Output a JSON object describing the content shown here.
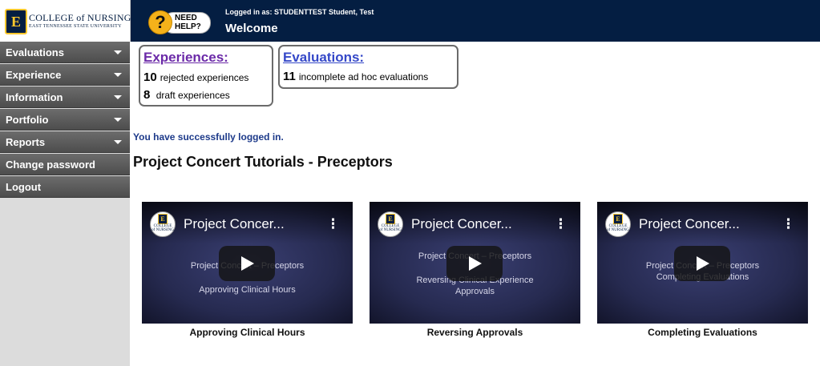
{
  "header": {
    "logo_letter": "E",
    "college_name_prefix": "COLLEGE of",
    "college_name_main": "NURSING",
    "university": "EAST TENNESSEE STATE UNIVERSITY",
    "help_label": "NEED\nHELP?",
    "help_mark": "?",
    "logged_in_text": "Logged in as: STUDENTTEST Student, Test",
    "welcome": "Welcome"
  },
  "sidebar": {
    "items": [
      {
        "label": "Evaluations",
        "has_dropdown": true
      },
      {
        "label": "Experience",
        "has_dropdown": true
      },
      {
        "label": "Information",
        "has_dropdown": true
      },
      {
        "label": "Portfolio",
        "has_dropdown": true
      },
      {
        "label": "Reports",
        "has_dropdown": true
      },
      {
        "label": "Change password",
        "has_dropdown": false
      },
      {
        "label": "Logout",
        "has_dropdown": false
      }
    ]
  },
  "summary": {
    "experiences": {
      "title": "Experiences:",
      "rejected_count": "10",
      "rejected_label": "rejected experiences",
      "draft_count": "8",
      "draft_label": "draft experiences"
    },
    "evaluations": {
      "title": "Evaluations:",
      "incomplete_count": "11",
      "incomplete_label": "incomplete ad hoc evaluations"
    }
  },
  "main": {
    "success_message": "You have successfully logged in.",
    "section_title": "Project Concert Tutorials - Preceptors",
    "videos": [
      {
        "title": "Project Concer...",
        "line1": "Project Concert – Preceptors",
        "line2": "Approving Clinical Hours",
        "line3": "",
        "caption": "Approving Clinical Hours"
      },
      {
        "title": "Project Concer...",
        "line1": "Project Concert – Preceptors",
        "line2": "Reversing Clinical Experience",
        "line3": "Approvals",
        "caption": "Reversing Approvals"
      },
      {
        "title": "Project Concer...",
        "line1": "Project Concert – Preceptors",
        "line2": "Completing Evaluations",
        "line3": "",
        "caption": "Completing Evaluations"
      }
    ],
    "channel_badge_letter": "E",
    "channel_badge_text": "COLLEGE of NURSING",
    "kebab": "⋮"
  },
  "colors": {
    "header_bg": "#041e42",
    "accent_gold": "#ffc72c",
    "sidebar_item": "#5a5a5a",
    "experiences_link": "#6b2aa8",
    "evaluations_link": "#3548c8",
    "success_text": "#1d3a8a"
  }
}
